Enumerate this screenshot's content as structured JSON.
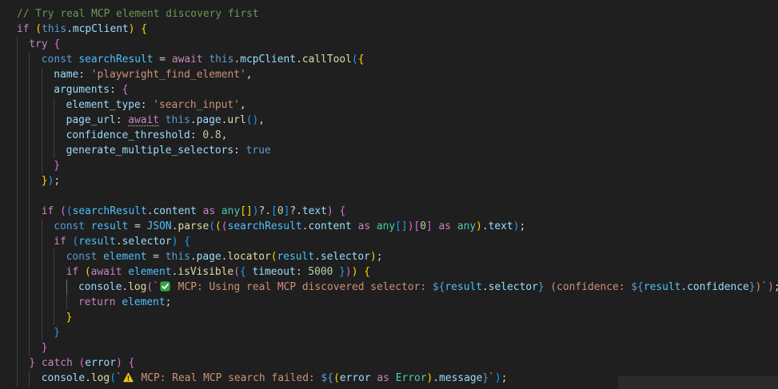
{
  "editor": {
    "name": "code-editor",
    "colors": {
      "background": "#1f1f1f",
      "comment": "#6a9955",
      "keyword": "#569cd6",
      "control": "#c586c0",
      "variable": "#9cdcfe",
      "constant": "#4fc1ff",
      "function": "#dcdcaa",
      "string": "#ce9178",
      "number": "#b5cea8",
      "type": "#4ec9b0",
      "punctuation": "#d4d4d4",
      "bracket1": "#ffd700",
      "bracket2": "#da70d6",
      "bracket3": "#179fff"
    },
    "lines": [
      {
        "indent": 0,
        "tokens": [
          [
            "// Try real MCP element discovery first",
            "comment"
          ]
        ]
      },
      {
        "indent": 0,
        "tokens": [
          [
            "if",
            "control"
          ],
          [
            " ",
            "plain"
          ],
          [
            "(",
            "bracket1"
          ],
          [
            "this",
            "keyword"
          ],
          [
            ".",
            "plain"
          ],
          [
            "mcpClient",
            "variable"
          ],
          [
            ")",
            "bracket1"
          ],
          [
            " ",
            "plain"
          ],
          [
            "{",
            "bracket1"
          ]
        ]
      },
      {
        "indent": 1,
        "tokens": [
          [
            "try",
            "control"
          ],
          [
            " ",
            "plain"
          ],
          [
            "{",
            "bracket2"
          ]
        ]
      },
      {
        "indent": 2,
        "tokens": [
          [
            "const",
            "keyword"
          ],
          [
            " ",
            "plain"
          ],
          [
            "searchResult",
            "constant"
          ],
          [
            " = ",
            "plain"
          ],
          [
            "await",
            "control"
          ],
          [
            " ",
            "plain"
          ],
          [
            "this",
            "keyword"
          ],
          [
            ".",
            "plain"
          ],
          [
            "mcpClient",
            "variable"
          ],
          [
            ".",
            "plain"
          ],
          [
            "callTool",
            "function"
          ],
          [
            "(",
            "bracket3"
          ],
          [
            "{",
            "bracket1"
          ]
        ]
      },
      {
        "indent": 3,
        "tokens": [
          [
            "name",
            "variable"
          ],
          [
            ": ",
            "plain"
          ],
          [
            "'playwright_find_element'",
            "string"
          ],
          [
            ",",
            "plain"
          ]
        ]
      },
      {
        "indent": 3,
        "tokens": [
          [
            "arguments",
            "variable"
          ],
          [
            ": ",
            "plain"
          ],
          [
            "{",
            "bracket2"
          ]
        ]
      },
      {
        "indent": 4,
        "tokens": [
          [
            "element_type",
            "variable"
          ],
          [
            ": ",
            "plain"
          ],
          [
            "'search_input'",
            "string"
          ],
          [
            ",",
            "plain"
          ]
        ]
      },
      {
        "indent": 4,
        "tokens": [
          [
            "page_url",
            "variable"
          ],
          [
            ": ",
            "plain"
          ],
          [
            "await",
            "control",
            "squiggle"
          ],
          [
            " ",
            "plain"
          ],
          [
            "this",
            "keyword"
          ],
          [
            ".",
            "plain"
          ],
          [
            "page",
            "variable"
          ],
          [
            ".",
            "plain"
          ],
          [
            "url",
            "function"
          ],
          [
            "()",
            "bracket3"
          ],
          [
            ",",
            "plain"
          ]
        ]
      },
      {
        "indent": 4,
        "tokens": [
          [
            "confidence_threshold",
            "variable"
          ],
          [
            ": ",
            "plain"
          ],
          [
            "0.8",
            "number"
          ],
          [
            ",",
            "plain"
          ]
        ]
      },
      {
        "indent": 4,
        "tokens": [
          [
            "generate_multiple_selectors",
            "variable"
          ],
          [
            ": ",
            "plain"
          ],
          [
            "true",
            "keyword"
          ]
        ]
      },
      {
        "indent": 3,
        "tokens": [
          [
            "}",
            "bracket2"
          ]
        ]
      },
      {
        "indent": 2,
        "tokens": [
          [
            "}",
            "bracket1"
          ],
          [
            ")",
            "bracket3"
          ],
          [
            ";",
            "plain"
          ]
        ]
      },
      {
        "indent": 2,
        "tokens": []
      },
      {
        "indent": 2,
        "tokens": [
          [
            "if",
            "control"
          ],
          [
            " ",
            "plain"
          ],
          [
            "(",
            "bracket2"
          ],
          [
            "(",
            "bracket3"
          ],
          [
            "searchResult",
            "constant"
          ],
          [
            ".",
            "plain"
          ],
          [
            "content",
            "variable"
          ],
          [
            " ",
            "plain"
          ],
          [
            "as",
            "control"
          ],
          [
            " ",
            "plain"
          ],
          [
            "any",
            "type"
          ],
          [
            "[]",
            "bracket1"
          ],
          [
            ")",
            "bracket3"
          ],
          [
            "?.",
            "plain"
          ],
          [
            "[",
            "bracket3"
          ],
          [
            "0",
            "number"
          ],
          [
            "]",
            "bracket3"
          ],
          [
            "?.",
            "plain"
          ],
          [
            "text",
            "variable"
          ],
          [
            ")",
            "bracket2"
          ],
          [
            " ",
            "plain"
          ],
          [
            "{",
            "bracket2"
          ]
        ]
      },
      {
        "indent": 3,
        "tokens": [
          [
            "const",
            "keyword"
          ],
          [
            " ",
            "plain"
          ],
          [
            "result",
            "constant"
          ],
          [
            " = ",
            "plain"
          ],
          [
            "JSON",
            "constant"
          ],
          [
            ".",
            "plain"
          ],
          [
            "parse",
            "function"
          ],
          [
            "(",
            "bracket3"
          ],
          [
            "(",
            "bracket1"
          ],
          [
            "(",
            "bracket2"
          ],
          [
            "searchResult",
            "constant"
          ],
          [
            ".",
            "plain"
          ],
          [
            "content",
            "variable"
          ],
          [
            " ",
            "plain"
          ],
          [
            "as",
            "control"
          ],
          [
            " ",
            "plain"
          ],
          [
            "any",
            "type"
          ],
          [
            "[]",
            "bracket3"
          ],
          [
            ")",
            "bracket2"
          ],
          [
            "[",
            "bracket2"
          ],
          [
            "0",
            "number"
          ],
          [
            "]",
            "bracket2"
          ],
          [
            " ",
            "plain"
          ],
          [
            "as",
            "control"
          ],
          [
            " ",
            "plain"
          ],
          [
            "any",
            "type"
          ],
          [
            ")",
            "bracket1"
          ],
          [
            ".",
            "plain"
          ],
          [
            "text",
            "variable"
          ],
          [
            ")",
            "bracket3"
          ],
          [
            ";",
            "plain"
          ]
        ]
      },
      {
        "indent": 3,
        "tokens": [
          [
            "if",
            "control"
          ],
          [
            " ",
            "plain"
          ],
          [
            "(",
            "bracket3"
          ],
          [
            "result",
            "constant"
          ],
          [
            ".",
            "plain"
          ],
          [
            "selector",
            "variable"
          ],
          [
            ")",
            "bracket3"
          ],
          [
            " ",
            "plain"
          ],
          [
            "{",
            "bracket3"
          ]
        ]
      },
      {
        "indent": 4,
        "tokens": [
          [
            "const",
            "keyword"
          ],
          [
            " ",
            "plain"
          ],
          [
            "element",
            "constant"
          ],
          [
            " = ",
            "plain"
          ],
          [
            "this",
            "keyword"
          ],
          [
            ".",
            "plain"
          ],
          [
            "page",
            "variable"
          ],
          [
            ".",
            "plain"
          ],
          [
            "locator",
            "function"
          ],
          [
            "(",
            "bracket1"
          ],
          [
            "result",
            "constant"
          ],
          [
            ".",
            "plain"
          ],
          [
            "selector",
            "variable"
          ],
          [
            ")",
            "bracket1"
          ],
          [
            ";",
            "plain"
          ]
        ]
      },
      {
        "indent": 4,
        "tokens": [
          [
            "if",
            "control"
          ],
          [
            " ",
            "plain"
          ],
          [
            "(",
            "bracket1"
          ],
          [
            "await",
            "control"
          ],
          [
            " ",
            "plain"
          ],
          [
            "element",
            "constant"
          ],
          [
            ".",
            "plain"
          ],
          [
            "isVisible",
            "function"
          ],
          [
            "(",
            "bracket2"
          ],
          [
            "{",
            "bracket3"
          ],
          [
            " ",
            "plain"
          ],
          [
            "timeout",
            "variable"
          ],
          [
            ": ",
            "plain"
          ],
          [
            "5000",
            "number"
          ],
          [
            " ",
            "plain"
          ],
          [
            "}",
            "bracket3"
          ],
          [
            ")",
            "bracket2"
          ],
          [
            ")",
            "bracket1"
          ],
          [
            " ",
            "plain"
          ],
          [
            "{",
            "bracket1"
          ]
        ]
      },
      {
        "indent": 5,
        "tokens": [
          [
            "console",
            "variable"
          ],
          [
            ".",
            "plain"
          ],
          [
            "log",
            "function"
          ],
          [
            "(",
            "bracket2"
          ],
          [
            "`",
            "string"
          ],
          [
            "@check",
            "emoji"
          ],
          [
            " MCP: Using real MCP discovered selector: ",
            "string"
          ],
          [
            "${",
            "keyword"
          ],
          [
            "result",
            "constant"
          ],
          [
            ".",
            "plain"
          ],
          [
            "selector",
            "variable"
          ],
          [
            "}",
            "keyword"
          ],
          [
            " (confidence: ",
            "string"
          ],
          [
            "${",
            "keyword"
          ],
          [
            "result",
            "constant"
          ],
          [
            ".",
            "plain"
          ],
          [
            "confidence",
            "variable"
          ],
          [
            "}",
            "keyword"
          ],
          [
            ")`",
            "string"
          ],
          [
            ")",
            "bracket2"
          ],
          [
            ";",
            "plain"
          ]
        ]
      },
      {
        "indent": 5,
        "tokens": [
          [
            "return",
            "control"
          ],
          [
            " ",
            "plain"
          ],
          [
            "element",
            "constant"
          ],
          [
            ";",
            "plain"
          ]
        ]
      },
      {
        "indent": 4,
        "tokens": [
          [
            "}",
            "bracket1"
          ]
        ]
      },
      {
        "indent": 3,
        "tokens": [
          [
            "}",
            "bracket3"
          ]
        ]
      },
      {
        "indent": 2,
        "tokens": [
          [
            "}",
            "bracket2"
          ]
        ]
      },
      {
        "indent": 1,
        "tokens": [
          [
            "}",
            "bracket2"
          ],
          [
            " ",
            "plain"
          ],
          [
            "catch",
            "control"
          ],
          [
            " ",
            "plain"
          ],
          [
            "(",
            "bracket2"
          ],
          [
            "error",
            "variable"
          ],
          [
            ")",
            "bracket2"
          ],
          [
            " ",
            "plain"
          ],
          [
            "{",
            "bracket2"
          ]
        ]
      },
      {
        "indent": 2,
        "tokens": [
          [
            "console",
            "variable"
          ],
          [
            ".",
            "plain"
          ],
          [
            "log",
            "function"
          ],
          [
            "(",
            "bracket3"
          ],
          [
            "`",
            "string"
          ],
          [
            "@warn",
            "emoji"
          ],
          [
            " MCP: Real MCP search failed: ",
            "string"
          ],
          [
            "${",
            "keyword"
          ],
          [
            "(",
            "bracket1"
          ],
          [
            "error",
            "variable"
          ],
          [
            " ",
            "plain"
          ],
          [
            "as",
            "control"
          ],
          [
            " ",
            "plain"
          ],
          [
            "Error",
            "type"
          ],
          [
            ")",
            "bracket1"
          ],
          [
            ".",
            "plain"
          ],
          [
            "message",
            "variable"
          ],
          [
            "}",
            "keyword"
          ],
          [
            "`",
            "string"
          ],
          [
            ")",
            "bracket3"
          ],
          [
            ";",
            "plain"
          ]
        ]
      }
    ]
  }
}
